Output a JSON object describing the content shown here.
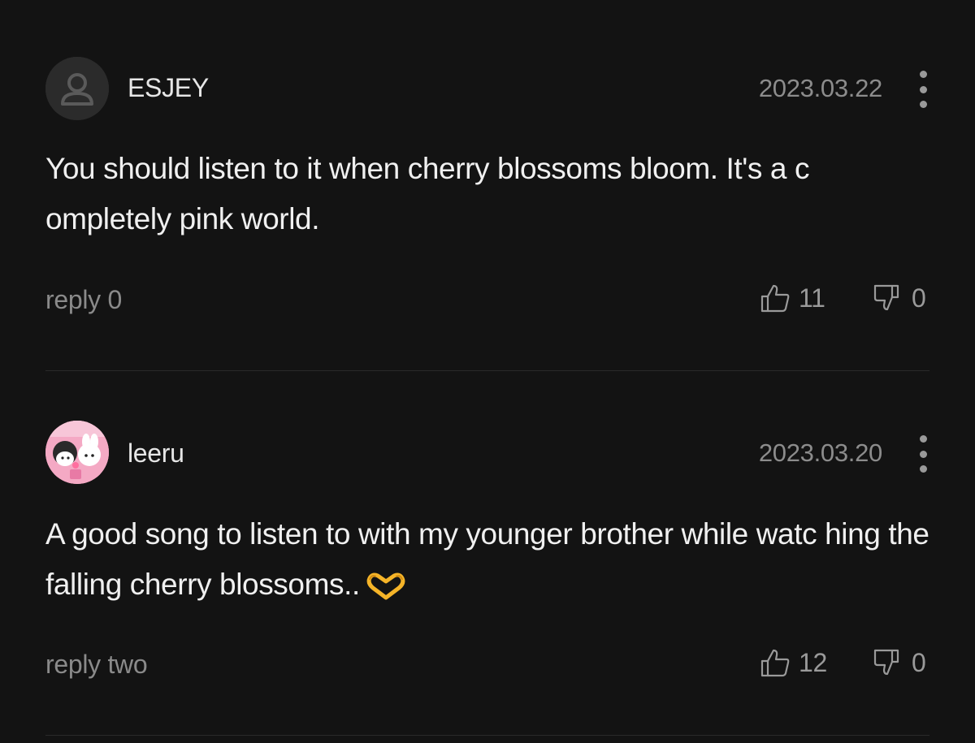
{
  "comments": [
    {
      "username": "ESJEY",
      "date": "2023.03.22",
      "avatar": "default-user-icon",
      "body": "You should listen to it when cherry blossoms bloom. It's a c ompletely pink world.",
      "reply": "reply 0",
      "likes": "11",
      "dislikes": "0"
    },
    {
      "username": "leeru",
      "date": "2023.03.20",
      "avatar": "character-avatar-pink",
      "body": "A good song to listen to with my younger brother while watc hing the falling cherry blossoms..",
      "emoji": "heart-hands-emoji",
      "reply": "reply two",
      "likes": "12",
      "dislikes": "0"
    }
  ],
  "colors": {
    "background": "#131313",
    "text": "#f0f0f0",
    "muted": "#8a8a8a",
    "divider": "#2a2a2a",
    "avatar_bg": "#2b2b2b",
    "emoji": "#f5b428"
  }
}
